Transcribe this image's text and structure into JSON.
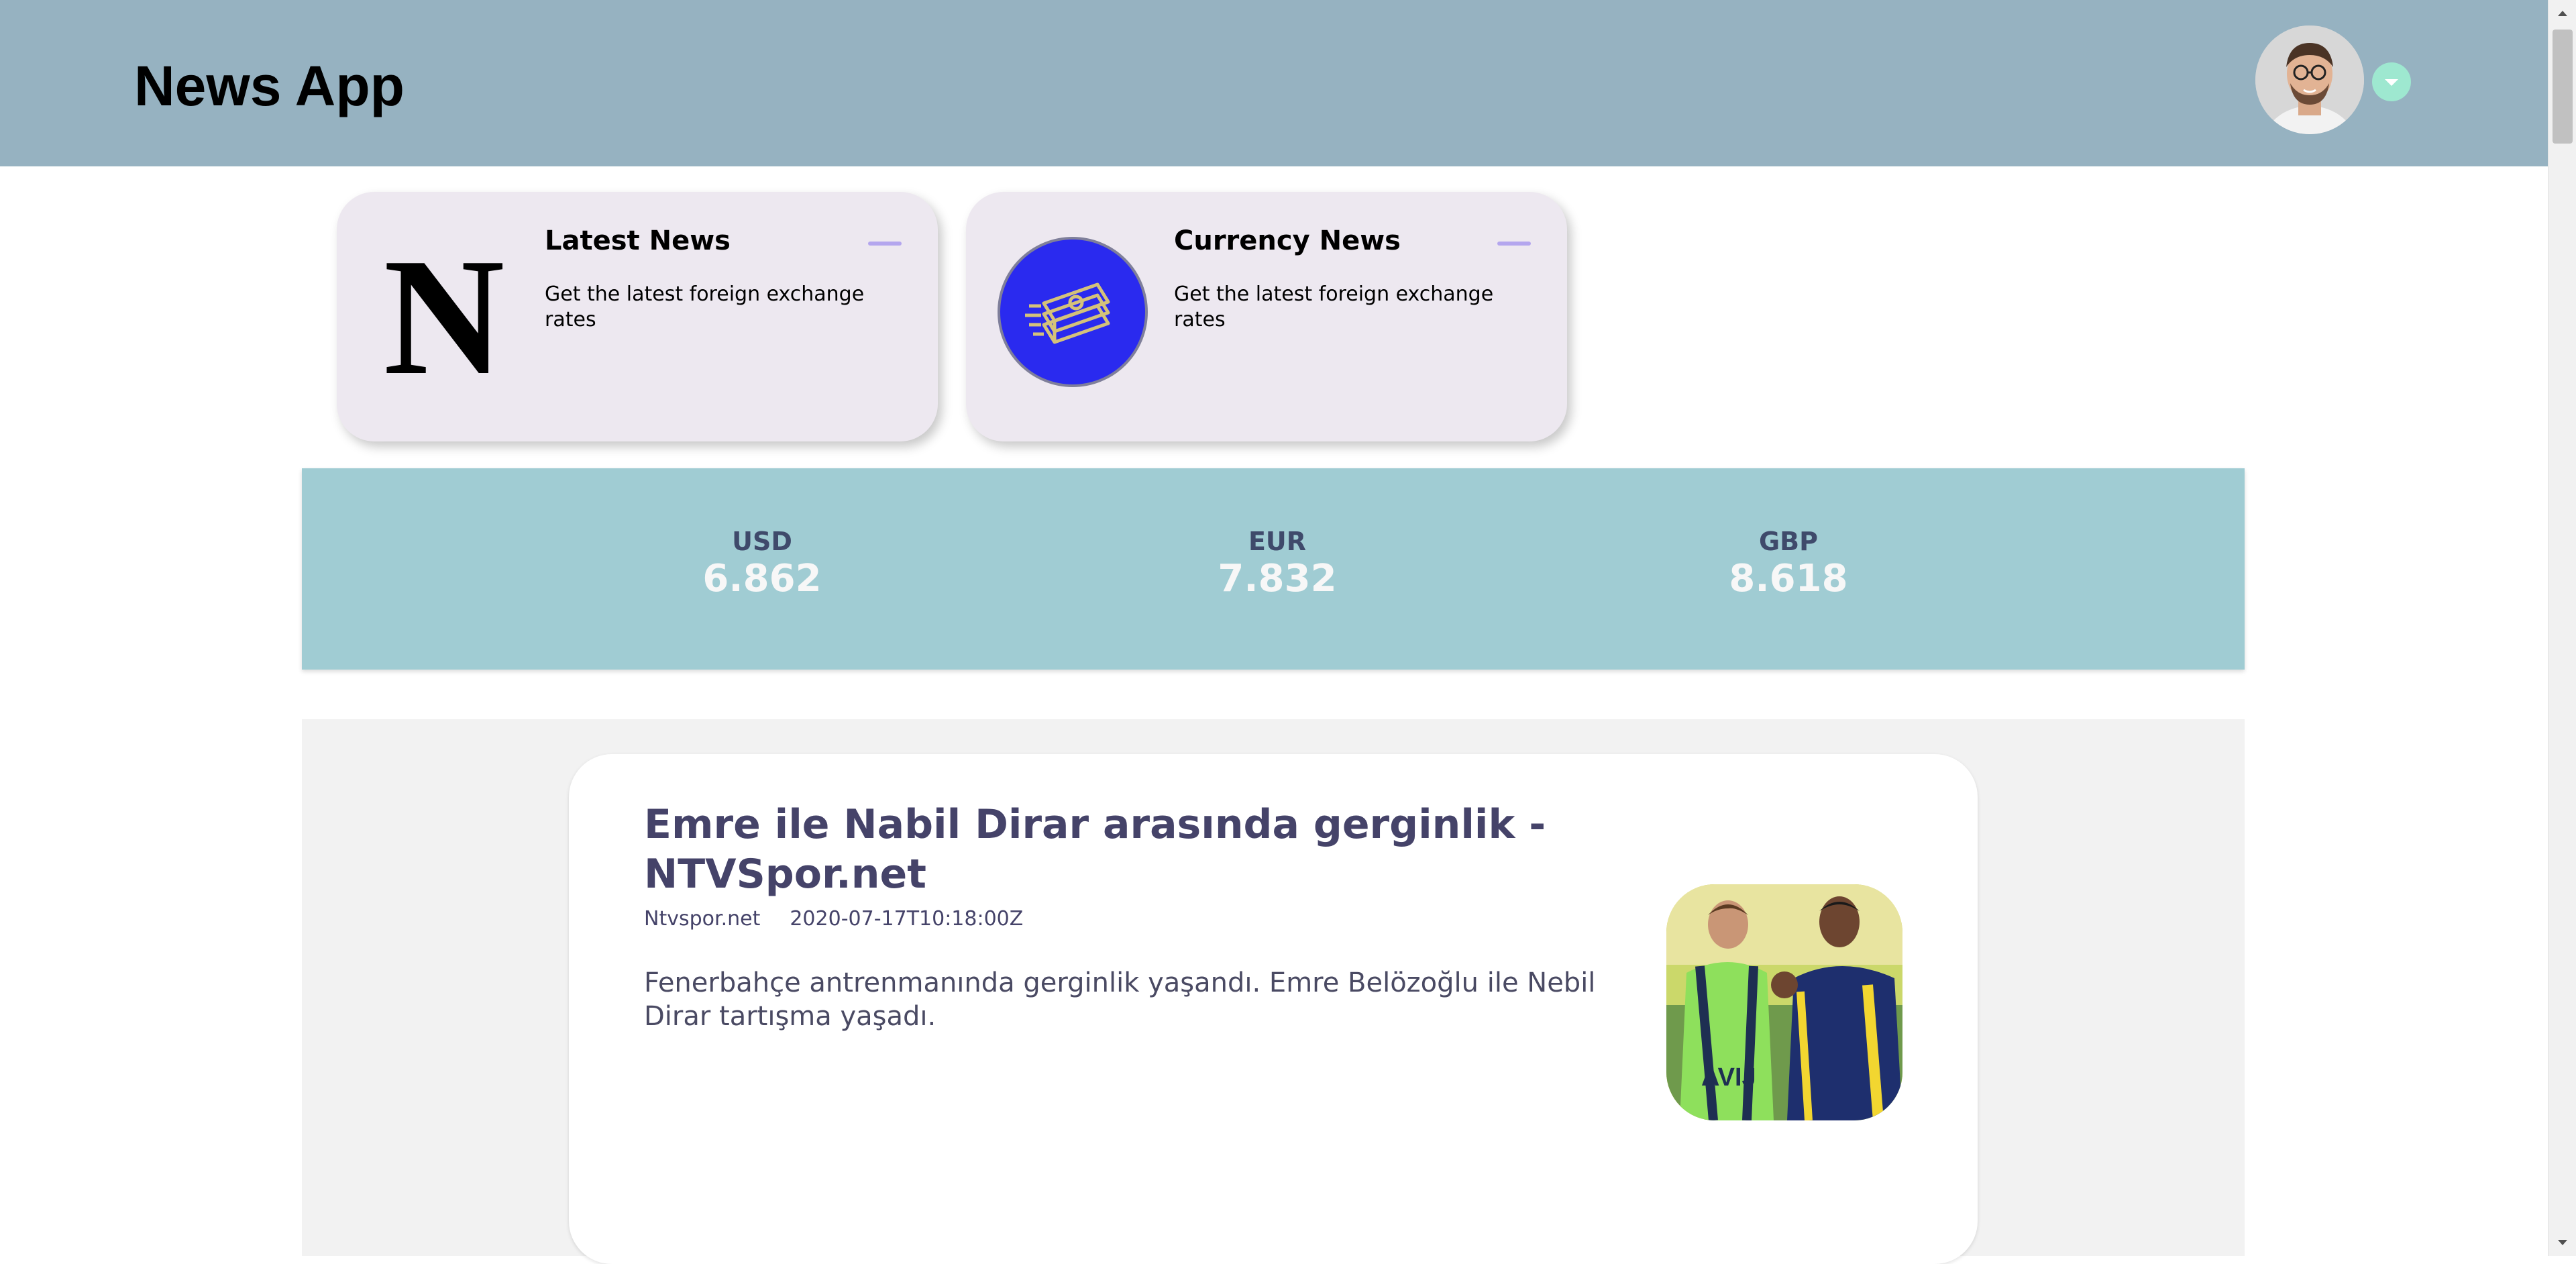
{
  "header": {
    "title": "News App",
    "background": "#96b2c1",
    "avatar_icon": "user-avatar",
    "dropdown_icon": "chevron-down-icon",
    "dropdown_color": "#9ee8d0"
  },
  "cards": [
    {
      "title": "Latest News",
      "description": "Get the latest foreign exchange rates",
      "icon": "newspaper-n-logo",
      "action_icon": "minimize-icon"
    },
    {
      "title": "Currency News",
      "description": "Get the latest foreign exchange rates",
      "icon": "money-stack-icon",
      "action_icon": "minimize-icon"
    }
  ],
  "rates": {
    "usd": {
      "code": "USD",
      "value": "6.862"
    },
    "eur": {
      "code": "EUR",
      "value": "7.832"
    },
    "gbp": {
      "code": "GBP",
      "value": "8.618"
    },
    "background": "#a0ccd3"
  },
  "articles": [
    {
      "title": "Emre ile Nabil Dirar arasında gerginlik - NTVSpor.net",
      "source": "Ntvspor.net",
      "published": "2020-07-17T10:18:00Z",
      "description": "Fenerbahçe antrenmanında gerginlik yaşandı. Emre Belözoğlu ile Nebil Dirar tartışma yaşadı.",
      "image_icon": "football-players-photo"
    }
  ],
  "colors": {
    "accent": "#454369",
    "card_bg": "#ede8f0",
    "minimize": "#b4a6ee",
    "currency_logo_bg": "#2a2aef"
  }
}
